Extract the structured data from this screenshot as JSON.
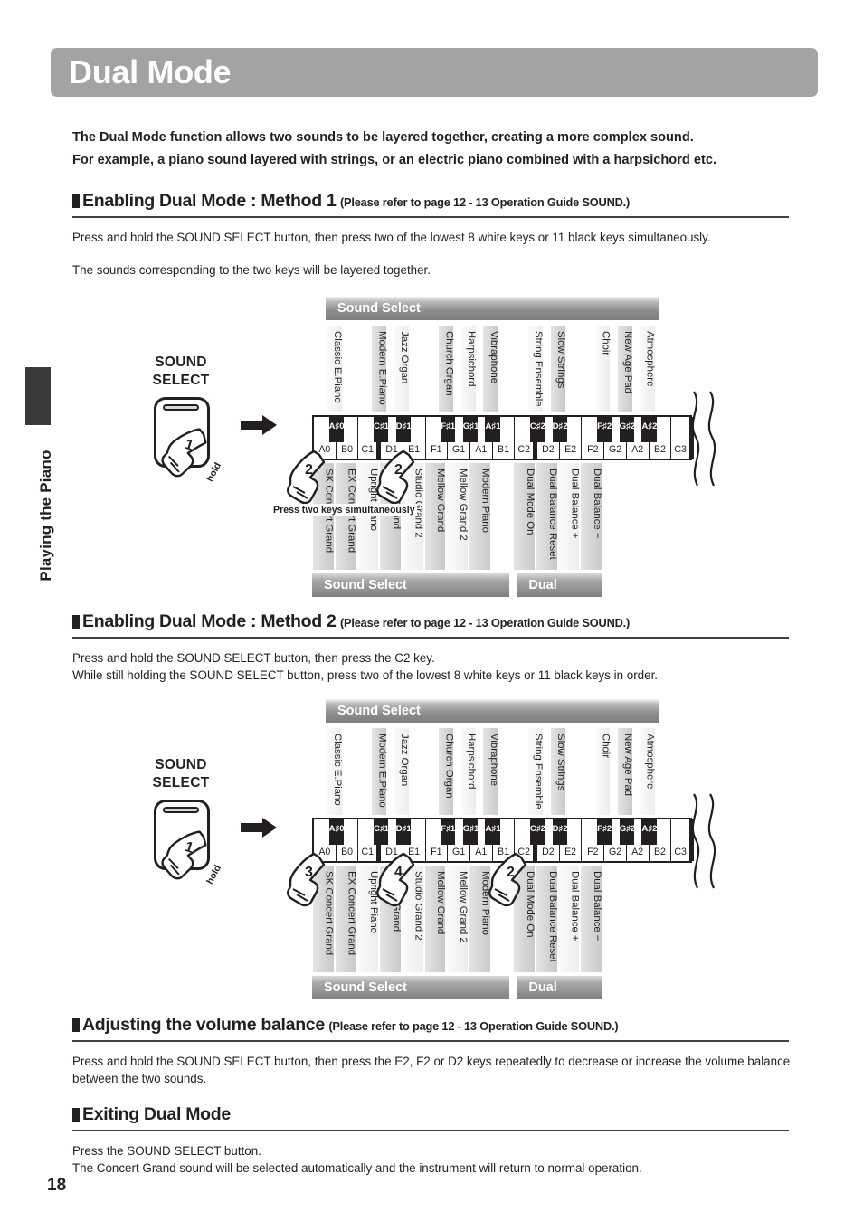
{
  "page": {
    "title": "Dual Mode",
    "number": "18",
    "side_tab_label": "Playing the Piano"
  },
  "intro": {
    "line1": "The Dual Mode function allows two sounds to be layered together, creating a more complex sound.",
    "line2": "For example, a piano sound layered with strings, or an electric piano combined with a harpsichord etc."
  },
  "sections": [
    {
      "heading": "Enabling Dual Mode : Method 1",
      "sub": "(Please refer to page 12 - 13 Operation Guide SOUND.)",
      "body1": "Press and hold the SOUND SELECT button, then press two of the lowest 8 white keys or 11 black keys simultaneously.",
      "body2": "The sounds corresponding to the two keys will be layered together."
    },
    {
      "heading": "Enabling Dual Mode : Method 2",
      "sub": "(Please refer to page 12 - 13 Operation Guide SOUND.)",
      "body1": "Press and hold the SOUND SELECT button, then press the C2 key.",
      "body2": "While still holding the SOUND SELECT button, press two of the lowest 8 white keys or 11 black keys in order."
    },
    {
      "heading": "Adjusting the volume balance",
      "sub": "(Please refer to page 12 - 13 Operation Guide SOUND.)",
      "body1": "Press and hold the SOUND SELECT button, then press the E2, F2 or D2 keys repeatedly to decrease or increase the volume balance",
      "body2": "between the two sounds."
    },
    {
      "heading": "Exiting Dual Mode",
      "sub": "",
      "body1": "Press the SOUND SELECT button.",
      "body2": "The Concert Grand sound will be selected automatically and the instrument will return to normal operation."
    }
  ],
  "figure": {
    "button_label_line1": "SOUND",
    "button_label_line2": "SELECT",
    "hold_text": "hold",
    "top_bar_label": "Sound Select",
    "bottom_bar_left_label": "Sound Select",
    "bottom_bar_right_label": "Dual",
    "simultaneous_note": "Press two keys simultaneously",
    "white_keys": [
      "A0",
      "B0",
      "C1",
      "D1",
      "E1",
      "F1",
      "G1",
      "A1",
      "B1",
      "C2",
      "D2",
      "E2",
      "F2",
      "G2",
      "A2",
      "B2",
      "C3"
    ],
    "black_keys": [
      "A#0",
      "C#1",
      "D#1",
      "F#1",
      "G#1",
      "A#1",
      "C#2",
      "D#2",
      "F#2",
      "G#2",
      "A#2"
    ],
    "black_key_after": [
      "A0",
      "C1",
      "D1",
      "F1",
      "G1",
      "A1",
      "C2",
      "D2",
      "F2",
      "G2",
      "A2"
    ],
    "top_labels": [
      {
        "key": "A#0",
        "text": "Classic E.Piano",
        "shade": "light"
      },
      {
        "key": "C#1",
        "text": "Modern E.Piano",
        "shade": "dark"
      },
      {
        "key": "D#1",
        "text": "Jazz Organ",
        "shade": "light"
      },
      {
        "key": "F#1",
        "text": "Church Organ",
        "shade": "dark"
      },
      {
        "key": "G#1",
        "text": "Harpsichord",
        "shade": "light"
      },
      {
        "key": "A#1",
        "text": "Vibraphone",
        "shade": "dark"
      },
      {
        "key": "C#2",
        "text": "String Ensemble",
        "shade": "light"
      },
      {
        "key": "D#2",
        "text": "Slow Strings",
        "shade": "dark"
      },
      {
        "key": "F#2",
        "text": "Choir",
        "shade": "light"
      },
      {
        "key": "G#2",
        "text": "New Age Pad",
        "shade": "dark"
      },
      {
        "key": "A#2",
        "text": "Atmosphere",
        "shade": "light"
      }
    ],
    "bottom_labels": [
      {
        "key": "A0",
        "text": "SK Concert Grand",
        "shade": "dark"
      },
      {
        "key": "B0",
        "text": "EX Concert Grand",
        "shade": "dark"
      },
      {
        "key": "C1",
        "text": "Upright Piano",
        "shade": "light"
      },
      {
        "key": "D1",
        "text": "Studio Grand",
        "shade": "dark"
      },
      {
        "key": "E1",
        "text": "Studio Grand 2",
        "shade": "light"
      },
      {
        "key": "F1",
        "text": "Mellow Grand",
        "shade": "dark"
      },
      {
        "key": "G1",
        "text": "Mellow Grand 2",
        "shade": "light"
      },
      {
        "key": "A1",
        "text": "Modern Piano",
        "shade": "dark"
      },
      {
        "key": "C2",
        "text": "Dual Mode On",
        "shade": "dark"
      },
      {
        "key": "D2",
        "text": "Dual Balance Reset",
        "shade": "dark"
      },
      {
        "key": "E2",
        "text": "Dual Balance +",
        "shade": "light"
      },
      {
        "key": "F2",
        "text": "Dual Balance −",
        "shade": "dark"
      }
    ],
    "method1_hands": [
      {
        "num": "2",
        "key": "A0"
      },
      {
        "num": "2",
        "key": "E1"
      }
    ],
    "method2_hands": [
      {
        "num": "3",
        "key": "A0"
      },
      {
        "num": "4",
        "key": "E1"
      },
      {
        "num": "2",
        "key": "C2"
      }
    ],
    "button_press_number": "1"
  },
  "colors": {
    "title_bar": "#a3a3a3",
    "ink": "#231f20",
    "side_tab": "#3a3a3c"
  }
}
